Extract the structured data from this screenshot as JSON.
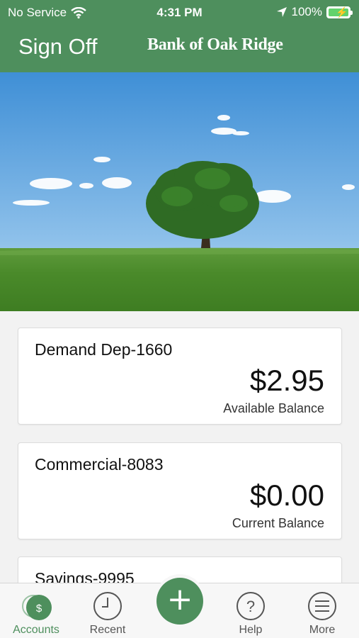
{
  "status_bar": {
    "carrier": "No Service",
    "time": "4:31 PM",
    "battery": "100%"
  },
  "header": {
    "sign_off_label": "Sign Off",
    "bank_name": "Bank of Oak Ridge"
  },
  "accounts": [
    {
      "name": "Demand Dep-1660",
      "amount": "$2.95",
      "balance_label": "Available Balance"
    },
    {
      "name": "Commercial-8083",
      "amount": "$0.00",
      "balance_label": "Current Balance"
    },
    {
      "name": "Savings-9995",
      "amount": "",
      "balance_label": ""
    }
  ],
  "tabbar": {
    "items": [
      {
        "label": "Accounts",
        "icon": "dollar-icon"
      },
      {
        "label": "Recent",
        "icon": "clock-icon"
      },
      {
        "label": "Help",
        "icon": "question-icon"
      },
      {
        "label": "More",
        "icon": "menu-icon"
      }
    ],
    "add_icon": "plus-icon"
  },
  "colors": {
    "brand": "#4e8f5d"
  }
}
